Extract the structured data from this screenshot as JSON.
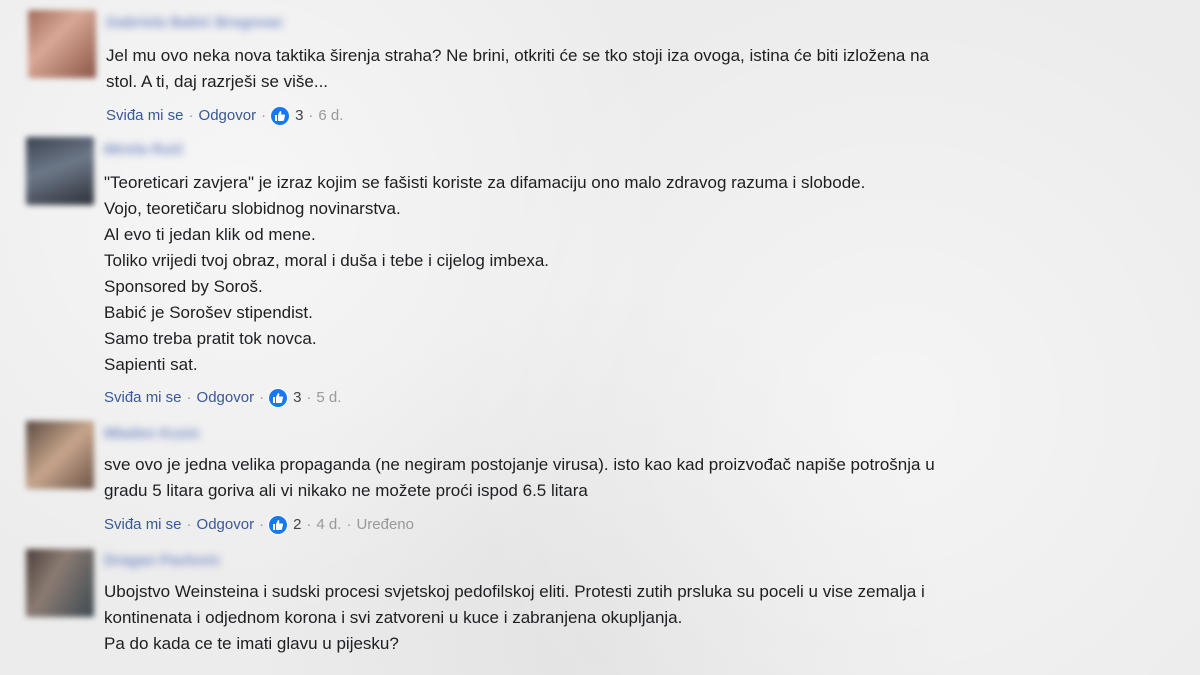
{
  "comments": [
    {
      "author": "Gabriela Babić Bregovac",
      "lines": [
        "Jel mu ovo neka nova taktika širenja straha? Ne brini, otkriti će se tko stoji iza ovoga, istina će biti izložena na",
        "stol. A ti, daj razrješi se više..."
      ],
      "like_label": "Sviđa mi se",
      "reply_label": "Odgovor",
      "reactions": "3",
      "time": "6 d.",
      "edited": ""
    },
    {
      "author": "Mirela Ruić",
      "lines": [
        "\"Teoreticari zavjera\" je izraz kojim se fašisti koriste za difamaciju ono malo zdravog razuma i slobode.",
        "Vojo, teoretičaru slobidnog novinarstva.",
        "Al evo ti jedan klik od mene.",
        "Toliko vrijedi tvoj obraz, moral i duša i tebe i cijelog imbexa.",
        "Sponsored by Soroš.",
        "Babić je Sorošev stipendist.",
        "Samo treba pratit tok novca.",
        "Sapienti sat."
      ],
      "like_label": "Sviđa mi se",
      "reply_label": "Odgovor",
      "reactions": "3",
      "time": "5 d.",
      "edited": ""
    },
    {
      "author": "Mladen Kusic",
      "lines": [
        "sve ovo je jedna velika propaganda (ne negiram postojanje virusa). isto kao kad proizvođač napiše potrošnja u",
        "gradu 5 litara goriva ali vi nikako ne možete proći ispod 6.5 litara"
      ],
      "like_label": "Sviđa mi se",
      "reply_label": "Odgovor",
      "reactions": "2",
      "time": "4 d.",
      "edited": "Uređeno"
    },
    {
      "author": "Dragan Pavlovic",
      "lines": [
        "Ubojstvo Weinsteina i sudski procesi svjetskoj pedofilskoj eliti. Protesti zutih prsluka su poceli u vise zemalja i",
        "kontinenata i odjednom korona i svi zatvoreni u kuce i zabranjena okupljanja.",
        "Pa do kada ce te imati glavu u pijesku?"
      ],
      "like_label": "",
      "reply_label": "",
      "reactions": "",
      "time": "",
      "edited": ""
    }
  ],
  "colors": {
    "link": "#385898",
    "like_badge": "#1877f2",
    "meta_gray": "#999999"
  },
  "icons": {
    "reaction": "thumbs-up-icon"
  }
}
